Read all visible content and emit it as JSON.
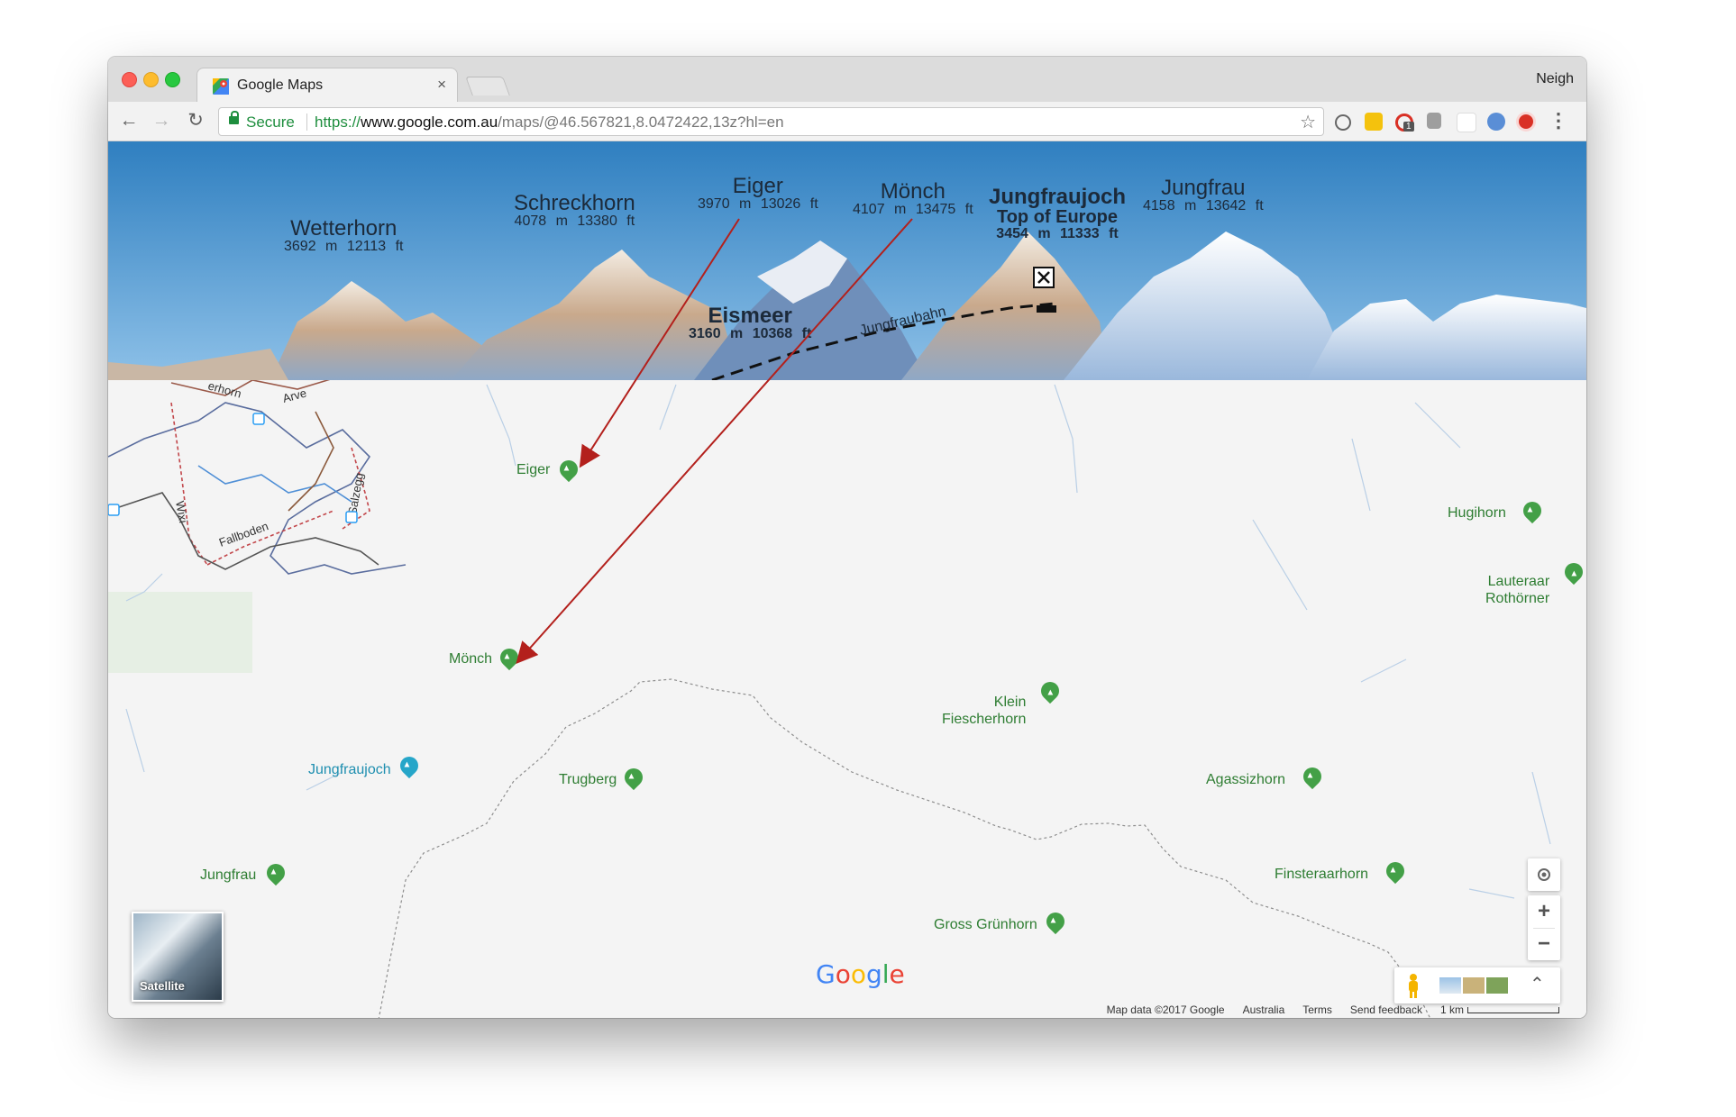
{
  "browser": {
    "tab_title": "Google Maps",
    "tab_close": "×",
    "profile_name": "Neigh",
    "secure_label": "Secure",
    "url_scheme": "https://",
    "url_host": "www.google.com.au",
    "url_path": "/maps/@46.567821,8.0472422,13z?hl=en",
    "back_glyph": "←",
    "forward_glyph": "→",
    "reload_glyph": "↻",
    "star_glyph": "☆",
    "menu_glyph": "⋮",
    "extensions": [
      "history-extension-icon",
      "notes-extension-icon",
      "badge-extension-icon",
      "clipboard-extension-icon",
      "blank-extension-icon",
      "timer-extension-icon",
      "record-extension-icon"
    ],
    "extension_badge": "1"
  },
  "panorama": {
    "peaks": [
      {
        "name": "Wetterhorn",
        "elev": "3692 m  12113 ft"
      },
      {
        "name": "Schreckhorn",
        "elev": "4078 m  13380 ft"
      },
      {
        "name": "Eiger",
        "elev": "3970 m  13026 ft"
      },
      {
        "name": "Mönch",
        "elev": "4107 m  13475 ft"
      },
      {
        "name": "Jungfraujoch",
        "subtitle": "Top of Europe",
        "elev": "3454 m  11333 ft"
      },
      {
        "name": "Jungfrau",
        "elev": "4158 m  13642 ft"
      },
      {
        "name": "Eismeer",
        "elev": "3160 m  10368 ft"
      }
    ],
    "railway": "Jungfraubahn"
  },
  "map": {
    "trail_labels": [
      "Arve",
      "Wixi",
      "Fallboden",
      "Salzegg",
      "erhorn"
    ],
    "pois": [
      {
        "name": "Eiger",
        "type": "peak"
      },
      {
        "name": "Mönch",
        "type": "peak"
      },
      {
        "name": "Jungfraujoch",
        "type": "station"
      },
      {
        "name": "Trugberg",
        "type": "peak"
      },
      {
        "name": "Jungfrau",
        "type": "peak"
      },
      {
        "name": "Klein\nFiescherhorn",
        "type": "peak"
      },
      {
        "name": "Agassizhorn",
        "type": "peak"
      },
      {
        "name": "Finsteraarhorn",
        "type": "peak"
      },
      {
        "name": "Gross Grünhorn",
        "type": "peak"
      },
      {
        "name": "Hugihorn",
        "type": "peak"
      },
      {
        "name": "Lauteraar\nRothörner",
        "type": "peak"
      }
    ],
    "satellite_label": "Satellite",
    "zoom_in": "+",
    "zoom_out": "−",
    "expand_glyph": "⌃",
    "logo_letters": [
      "G",
      "o",
      "o",
      "g",
      "l",
      "e"
    ],
    "logo_colors": [
      "#4285f4",
      "#ea4335",
      "#fbbc05",
      "#4285f4",
      "#34a853",
      "#ea4335"
    ],
    "footer": {
      "map_data": "Map data ©2017 Google",
      "region": "Australia",
      "terms": "Terms",
      "feedback": "Send feedback",
      "scale": "1 km"
    }
  },
  "colors": {
    "sky_top": "#2f7fc0",
    "sky_bottom": "#8ec1e8",
    "annotation_arrow": "#b3201c",
    "poi_green": "#2e7d32"
  }
}
